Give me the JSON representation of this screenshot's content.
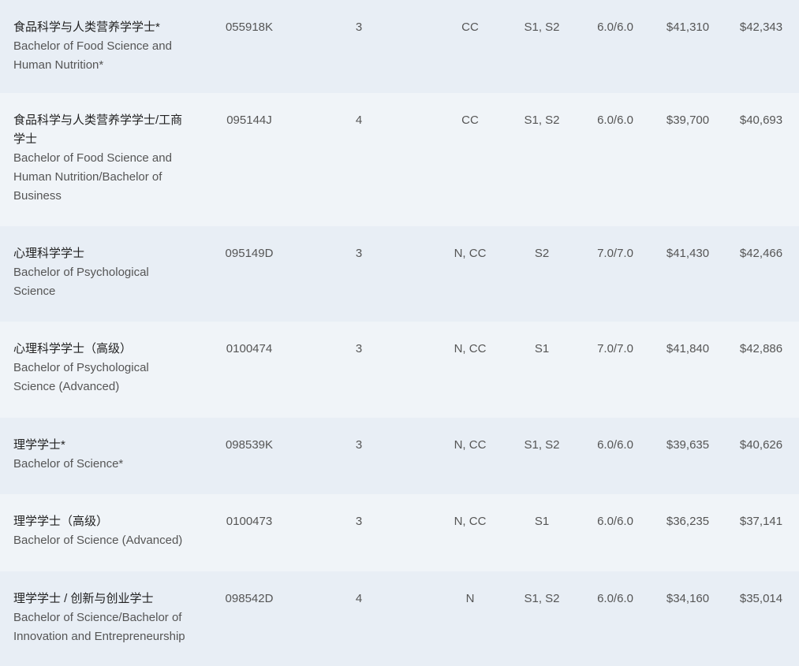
{
  "rows": [
    {
      "name_cn": "食品科学与人类营养学学士*",
      "name_en": "Bachelor of Food Science and Human Nutrition*",
      "code": "055918K",
      "duration": "3",
      "mode": "CC",
      "intake": "S1, S2",
      "ielts": "6.0/6.0",
      "fee1": "$41,310",
      "fee2": "$42,343"
    },
    {
      "name_cn": "食品科学与人类营养学学士/工商学士",
      "name_en": "Bachelor of Food Science and Human Nutrition/Bachelor of Business",
      "code": "095144J",
      "duration": "4",
      "mode": "CC",
      "intake": "S1, S2",
      "ielts": "6.0/6.0",
      "fee1": "$39,700",
      "fee2": "$40,693"
    },
    {
      "name_cn": "心理科学学士",
      "name_en": "Bachelor of Psychological Science",
      "code": "095149D",
      "duration": "3",
      "mode": "N, CC",
      "intake": "S2",
      "ielts": "7.0/7.0",
      "fee1": "$41,430",
      "fee2": "$42,466"
    },
    {
      "name_cn": "心理科学学士（高级）",
      "name_en": "Bachelor of Psychological Science (Advanced)",
      "code": "0100474",
      "duration": "3",
      "mode": "N, CC",
      "intake": "S1",
      "ielts": "7.0/7.0",
      "fee1": "$41,840",
      "fee2": "$42,886"
    },
    {
      "name_cn": "理学学士*",
      "name_en": "Bachelor of Science*",
      "code": "098539K",
      "duration": "3",
      "mode": "N, CC",
      "intake": "S1, S2",
      "ielts": "6.0/6.0",
      "fee1": "$39,635",
      "fee2": "$40,626"
    },
    {
      "name_cn": "理学学士（高级）",
      "name_en": "Bachelor of Science (Advanced)",
      "code": "0100473",
      "duration": "3",
      "mode": "N, CC",
      "intake": "S1",
      "ielts": "6.0/6.0",
      "fee1": "$36,235",
      "fee2": "$37,141"
    },
    {
      "name_cn": "理学学士 / 创新与创业学士",
      "name_en": "Bachelor of Science/Bachelor of Innovation and Entrepreneurship",
      "code": "098542D",
      "duration": "4",
      "mode": "N",
      "intake": "S1, S2",
      "ielts": "6.0/6.0",
      "fee1": "$34,160",
      "fee2": "$35,014"
    }
  ]
}
